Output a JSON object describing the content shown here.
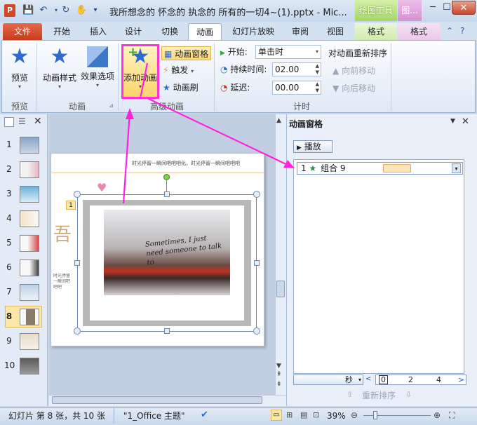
{
  "window": {
    "title": "我所想念的 怀念的 执念的 所有的一切4~(1).pptx - Mic...",
    "app_icon_letter": "P",
    "context_drawing": "绘图工具",
    "context_picture": "图...",
    "minimize": "─",
    "maximize": "☐",
    "close": "✕"
  },
  "tabs": {
    "file": "文件",
    "items": [
      "开始",
      "插入",
      "设计",
      "切换",
      "动画",
      "幻灯片放映",
      "审阅",
      "视图",
      "格式",
      "格式"
    ],
    "active": "动画"
  },
  "ribbon": {
    "preview": {
      "button": "预览",
      "group": "预览"
    },
    "animation": {
      "style_button": "动画样式",
      "effect_button": "效果选项",
      "group": "动画"
    },
    "advanced": {
      "add_button": "添加动画",
      "pane_button": "动画窗格",
      "trigger_button": "触发",
      "painter_button": "动画刷",
      "group": "高级动画"
    },
    "timing": {
      "start_label": "开始:",
      "start_value": "单击时",
      "duration_label": "持续时间:",
      "duration_value": "02.00",
      "delay_label": "延迟:",
      "delay_value": "00.00",
      "reorder_title": "对动画重新排序",
      "move_earlier": "向前移动",
      "move_later": "向后移动",
      "group": "计时"
    }
  },
  "thumbnails": [
    "1",
    "2",
    "3",
    "4",
    "5",
    "6",
    "7",
    "8",
    "9",
    "10"
  ],
  "selected_thumbnail": "8",
  "slide": {
    "header_text": "时光停留一瞬间吧吧吧化，时光停留一瞬间吧吧吧",
    "anim_tag": "1",
    "left_char": "吾",
    "photo_text": "Sometimes, I just need someone to talk to",
    "side_text": "时光停留一瞬间吧吧吧"
  },
  "anim_pane": {
    "title": "动画窗格",
    "play_button": "播放",
    "item_number": "1",
    "item_name": "组合 9",
    "seconds_label": "秒",
    "timeline_ticks": [
      "0",
      "2",
      "4"
    ],
    "reorder_label": "重新排序"
  },
  "statusbar": {
    "slide_info": "幻灯片 第 8 张，共 10 张",
    "theme": "\"1_Office 主题\"",
    "zoom": "39%"
  },
  "colors": {
    "file_tab": "#c43d1c",
    "accent_highlight": "#ff33dd",
    "anim_star": "#2d6bd0"
  }
}
